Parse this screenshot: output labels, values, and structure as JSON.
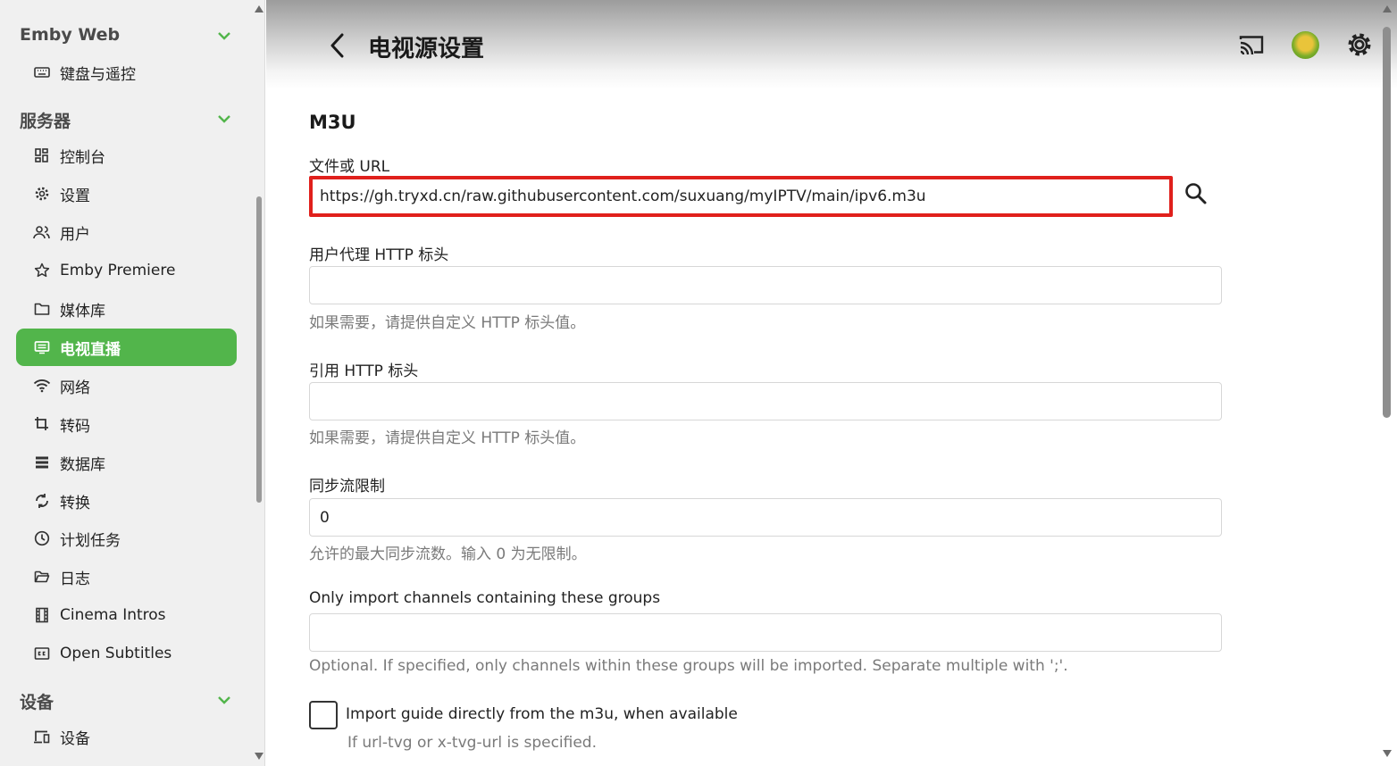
{
  "sidebar": {
    "sections": [
      {
        "title": "Emby Web"
      },
      {
        "title": "服务器"
      },
      {
        "title": "设备"
      }
    ],
    "items": [
      {
        "label": "键盘与遥控",
        "icon": "keyboard-icon"
      },
      {
        "label": "控制台",
        "icon": "dashboard-icon"
      },
      {
        "label": "设置",
        "icon": "gear-icon"
      },
      {
        "label": "用户",
        "icon": "users-icon"
      },
      {
        "label": "Emby Premiere",
        "icon": "star-icon"
      },
      {
        "label": "媒体库",
        "icon": "folder-icon"
      },
      {
        "label": "电视直播",
        "icon": "live-tv-icon",
        "active": true
      },
      {
        "label": "网络",
        "icon": "wifi-icon"
      },
      {
        "label": "转码",
        "icon": "transcode-icon"
      },
      {
        "label": "数据库",
        "icon": "database-icon"
      },
      {
        "label": "转换",
        "icon": "convert-icon"
      },
      {
        "label": "计划任务",
        "icon": "clock-icon"
      },
      {
        "label": "日志",
        "icon": "folder-open-icon"
      },
      {
        "label": "Cinema Intros",
        "icon": "film-icon"
      },
      {
        "label": "Open Subtitles",
        "icon": "subtitles-icon"
      },
      {
        "label": "设备",
        "icon": "devices-icon"
      }
    ]
  },
  "header": {
    "title": "电视源设置",
    "icons": [
      "back-arrow-icon",
      "cast-icon",
      "avatar",
      "gear-icon"
    ]
  },
  "form": {
    "section_title": "M3U",
    "file_url": {
      "label": "文件或 URL",
      "value": "https://gh.tryxd.cn/raw.githubusercontent.com/suxuang/myIPTV/main/ipv6.m3u"
    },
    "user_agent": {
      "label": "用户代理 HTTP 标头",
      "value": "",
      "help": "如果需要，请提供自定义 HTTP 标头值。"
    },
    "referer": {
      "label": "引用 HTTP 标头",
      "value": "",
      "help": "如果需要，请提供自定义 HTTP 标头值。"
    },
    "stream_limit": {
      "label": "同步流限制",
      "value": "0",
      "help": "允许的最大同步流数。输入 0 为无限制。"
    },
    "groups": {
      "label": "Only import channels containing these groups",
      "value": "",
      "help": "Optional. If specified, only channels within these groups will be imported. Separate multiple with ';'."
    },
    "import_guide": {
      "label": "Import guide directly from the m3u, when available",
      "help": "If url-tvg or x-tvg-url is specified.",
      "checked": false
    }
  },
  "colors": {
    "accent": "#52b54b",
    "highlight_border": "#e0201c"
  }
}
